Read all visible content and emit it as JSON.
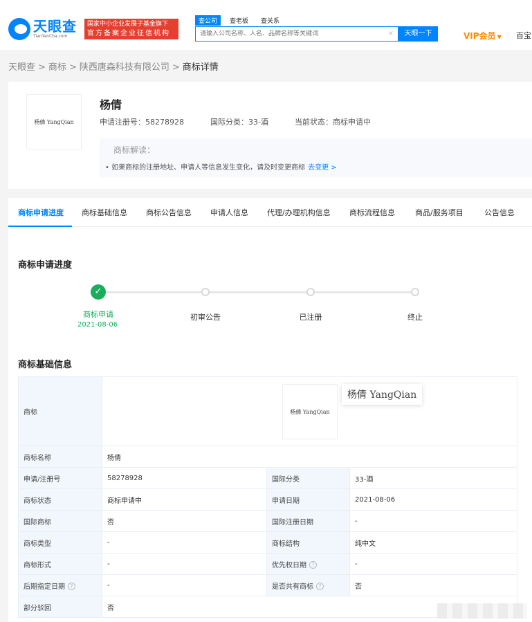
{
  "header": {
    "logo_cn": "天眼查",
    "logo_en": "TianYanCha.com",
    "badge_line1": "国家中小企业发展子基金旗下",
    "badge_line2": "官方备案企业征信机构",
    "search_tabs": [
      "查公司",
      "查老板",
      "查关系"
    ],
    "search_placeholder": "请输入公司名称、人名、品牌名称等关键词",
    "search_button": "天眼一下",
    "vip": "VIP会员",
    "baibao": "百宝"
  },
  "breadcrumb": {
    "items": [
      "天眼查",
      "商标",
      "陕西唐森科技有限公司"
    ],
    "current": "商标详情"
  },
  "trademark": {
    "name": "杨倩",
    "image_text": "杨倩 YangQian",
    "reg_no_label": "申请注册号：58278928",
    "class_label": "国际分类：33-酒",
    "status_label": "当前状态：商标申请中",
    "notice_title": "商标解读：",
    "notice_text": "• 如果商标的注册地址、申请人等信息发生变化，请及时变更商标",
    "notice_link": "去变更 >"
  },
  "tabs": [
    "商标申请进度",
    "商标基础信息",
    "商标公告信息",
    "申请人信息",
    "代理/办理机构信息",
    "商标流程信息",
    "商品/服务项目",
    "公告信息"
  ],
  "progress": {
    "title": "商标申请进度",
    "steps": [
      {
        "label": "商标申请",
        "date": "2021-08-06",
        "done": true
      },
      {
        "label": "初审公告",
        "date": "",
        "done": false
      },
      {
        "label": "已注册",
        "date": "",
        "done": false
      },
      {
        "label": "终止",
        "date": "",
        "done": false
      }
    ]
  },
  "basic": {
    "title": "商标基础信息",
    "rows": {
      "tm_label": "商标",
      "name_label": "商标名称",
      "name_value": "杨倩",
      "regno_label": "申请/注册号",
      "regno_value": "58278928",
      "class_label": "国际分类",
      "class_value": "33-酒",
      "status_label": "商标状态",
      "status_value": "商标申请中",
      "date_label": "申请日期",
      "date_value": "2021-08-06",
      "intl_label": "国际商标",
      "intl_value": "否",
      "intl_date_label": "国际注册日期",
      "intl_date_value": "-",
      "type_label": "商标类型",
      "type_value": "-",
      "struct_label": "商标结构",
      "struct_value": "纯中文",
      "form_label": "商标形式",
      "form_value": "-",
      "priority_label": "优先权日期",
      "priority_value": "-",
      "later_label": "后期指定日期",
      "later_value": "-",
      "shared_label": "是否共有商标",
      "shared_value": "否",
      "partial_label": "部分驳回",
      "partial_value": "否"
    }
  },
  "colors": {
    "brand": "#0084ff",
    "success": "#1aad5b",
    "vip": "#ff8a00",
    "badge": "#e53f30"
  }
}
